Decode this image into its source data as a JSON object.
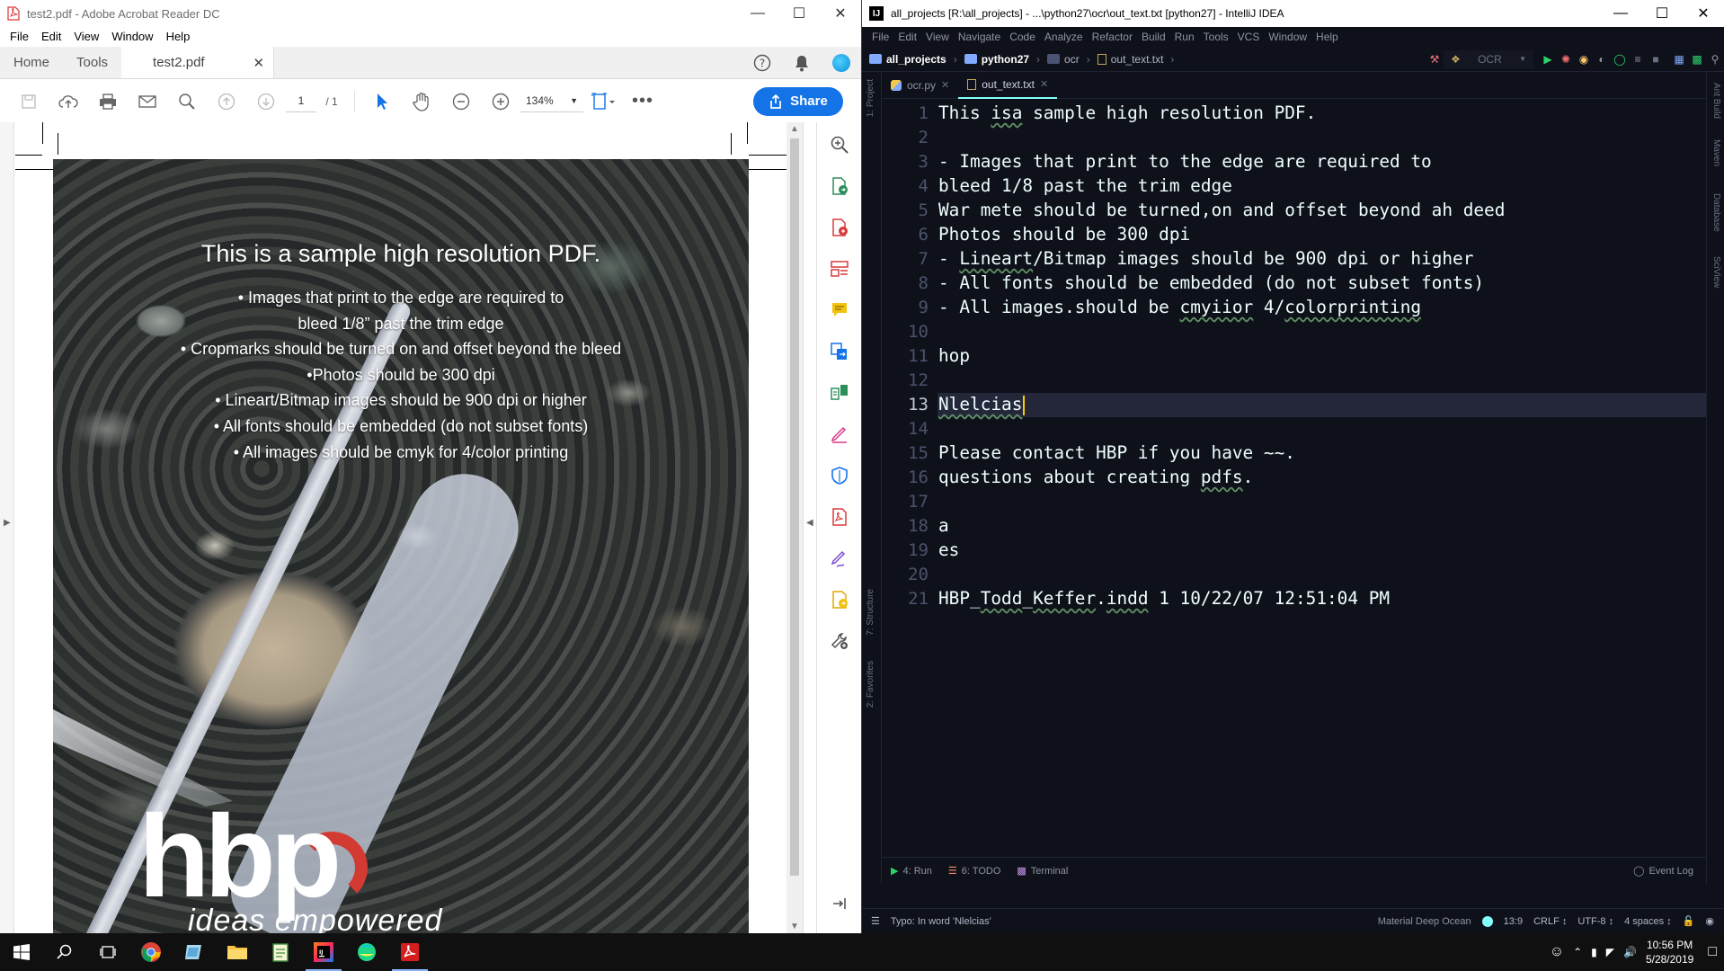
{
  "acrobat": {
    "window_title": "test2.pdf - Adobe Acrobat Reader DC",
    "menu": [
      "File",
      "Edit",
      "View",
      "Window",
      "Help"
    ],
    "tabs": {
      "home": "Home",
      "tools": "Tools",
      "doc": "test2.pdf"
    },
    "page_current": "1",
    "page_total": "/ 1",
    "zoom": "134%",
    "share_label": "Share",
    "document": {
      "title": "This is a sample high resolution PDF.",
      "lines": [
        "• Images that print to the edge are required to",
        "bleed 1/8” past the trim edge",
        "• Cropmarks should be turned on and offset beyond the bleed",
        "•Photos should be 300 dpi",
        "• Lineart/Bitmap images should be 900 dpi or higher",
        "• All fonts should be embedded (do not subset fonts)",
        "• All images should be cmyk for 4/color printing"
      ],
      "logo_text": "hbp",
      "logo_tagline": "ideas empowered"
    }
  },
  "idea": {
    "window_title": "all_projects [R:\\all_projects] - ...\\python27\\ocr\\out_text.txt [python27] - IntelliJ IDEA",
    "menu": [
      "File",
      "Edit",
      "View",
      "Navigate",
      "Code",
      "Analyze",
      "Refactor",
      "Build",
      "Run",
      "Tools",
      "VCS",
      "Window",
      "Help"
    ],
    "breadcrumbs": [
      "all_projects",
      "python27",
      "ocr",
      "out_text.txt"
    ],
    "run_config": "OCR",
    "tabs": [
      "ocr.py",
      "out_text.txt"
    ],
    "left_panels": [
      "1: Project",
      "7: Structure",
      "2: Favorites"
    ],
    "right_panels": [
      "Ant Build",
      "Maven",
      "Database",
      "SciView"
    ],
    "current_line": 13,
    "lines": [
      "This isa sample high resolution PDF.",
      "",
      "- Images that print to the edge are required to",
      "bleed 1/8 past the trim edge",
      "War mete should be turned,on and offset beyond ah deed",
      "Photos should be 300 dpi",
      "- Lineart/Bitmap images should be 900 dpi or higher",
      "- All fonts should be embedded (do not subset fonts)",
      "- All images.should be cmyiior 4/colorprinting",
      "",
      "hop",
      "",
      "Nlelcias",
      "",
      "Please contact HBP if you have ~~.",
      "questions about creating pdfs.",
      "",
      "a",
      "es",
      "",
      "HBP_Todd_Keffer.indd 1 10/22/07 12:51:04 PM"
    ],
    "bottom_tabs": {
      "run": "4: Run",
      "todo": "6: TODO",
      "terminal": "Terminal",
      "event_log": "Event Log"
    },
    "status": {
      "message": "Typo: In word 'Nlelcias'",
      "theme": "Material Deep Ocean",
      "position": "13:9",
      "line_sep": "CRLF ↕",
      "encoding": "UTF-8 ↕",
      "indent": "4 spaces ↕"
    }
  },
  "taskbar": {
    "time": "10:56 PM",
    "date": "5/28/2019"
  }
}
